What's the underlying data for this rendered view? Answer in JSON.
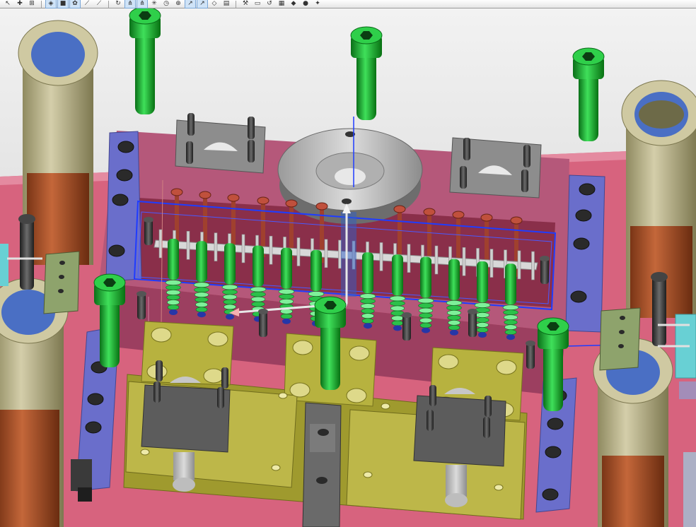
{
  "toolbar": {
    "groups": [
      [
        {
          "id": "select-icon",
          "glyph": "↖",
          "active": false
        },
        {
          "id": "snap-icon",
          "glyph": "✚",
          "active": false
        },
        {
          "id": "grid-icon",
          "glyph": "⊞",
          "active": false
        }
      ],
      [
        {
          "id": "view-wireframe-icon",
          "glyph": "◈",
          "active": true
        },
        {
          "id": "view-shaded-icon",
          "glyph": "■",
          "active": true
        },
        {
          "id": "color-palette-icon",
          "glyph": "✿",
          "active": true
        },
        {
          "id": "sketch-line-icon",
          "glyph": "⟋",
          "active": false
        },
        {
          "id": "measure-icon",
          "glyph": "⟋",
          "active": false
        }
      ],
      [
        {
          "id": "rotate-icon",
          "glyph": "↻",
          "active": false
        },
        {
          "id": "axis-x-icon",
          "glyph": "⋔",
          "active": true
        },
        {
          "id": "axis-y-icon",
          "glyph": "⋔",
          "active": true
        },
        {
          "id": "triad-icon",
          "glyph": "✳",
          "active": false
        },
        {
          "id": "clock-icon",
          "glyph": "◷",
          "active": false
        },
        {
          "id": "target-icon",
          "glyph": "⊕",
          "active": false
        },
        {
          "id": "pointer-icon",
          "glyph": "↗",
          "active": true
        },
        {
          "id": "pointer-alt-icon",
          "glyph": "↗",
          "active": true
        },
        {
          "id": "layers-icon",
          "glyph": "◇",
          "active": false
        },
        {
          "id": "book-icon",
          "glyph": "▤",
          "active": false
        }
      ],
      [
        {
          "id": "measure-tool-icon",
          "glyph": "⚒",
          "active": false
        },
        {
          "id": "folder-icon",
          "glyph": "▭",
          "active": false
        },
        {
          "id": "refresh-icon",
          "glyph": "↺",
          "active": false
        },
        {
          "id": "document-icon",
          "glyph": "▦",
          "active": false
        },
        {
          "id": "render-icon",
          "glyph": "◆",
          "active": false
        },
        {
          "id": "sphere-icon",
          "glyph": "●",
          "active": false
        },
        {
          "id": "palette-icon",
          "glyph": "✦",
          "active": false
        }
      ]
    ]
  },
  "colors": {
    "background": "#ece8ec",
    "base_plate": "#d7637e",
    "cavity_plate": "#b5587a",
    "cavity_interior": "#8a2f4a",
    "bushing_outer": "#b6ae82",
    "bushing_lower": "#a64e28",
    "bushing_bore": "#4a6fc4",
    "bolt_green": "#13a82a",
    "slide_blocks": "#b7b23f",
    "rail_blue": "#6a6ecb",
    "dark_parts": "#3b3b3b",
    "sprue_disc": "#9a9a9a",
    "selection_outline": "#1f3cff",
    "cyan_part": "#68d0d4",
    "olive_block": "#8ea36c"
  }
}
